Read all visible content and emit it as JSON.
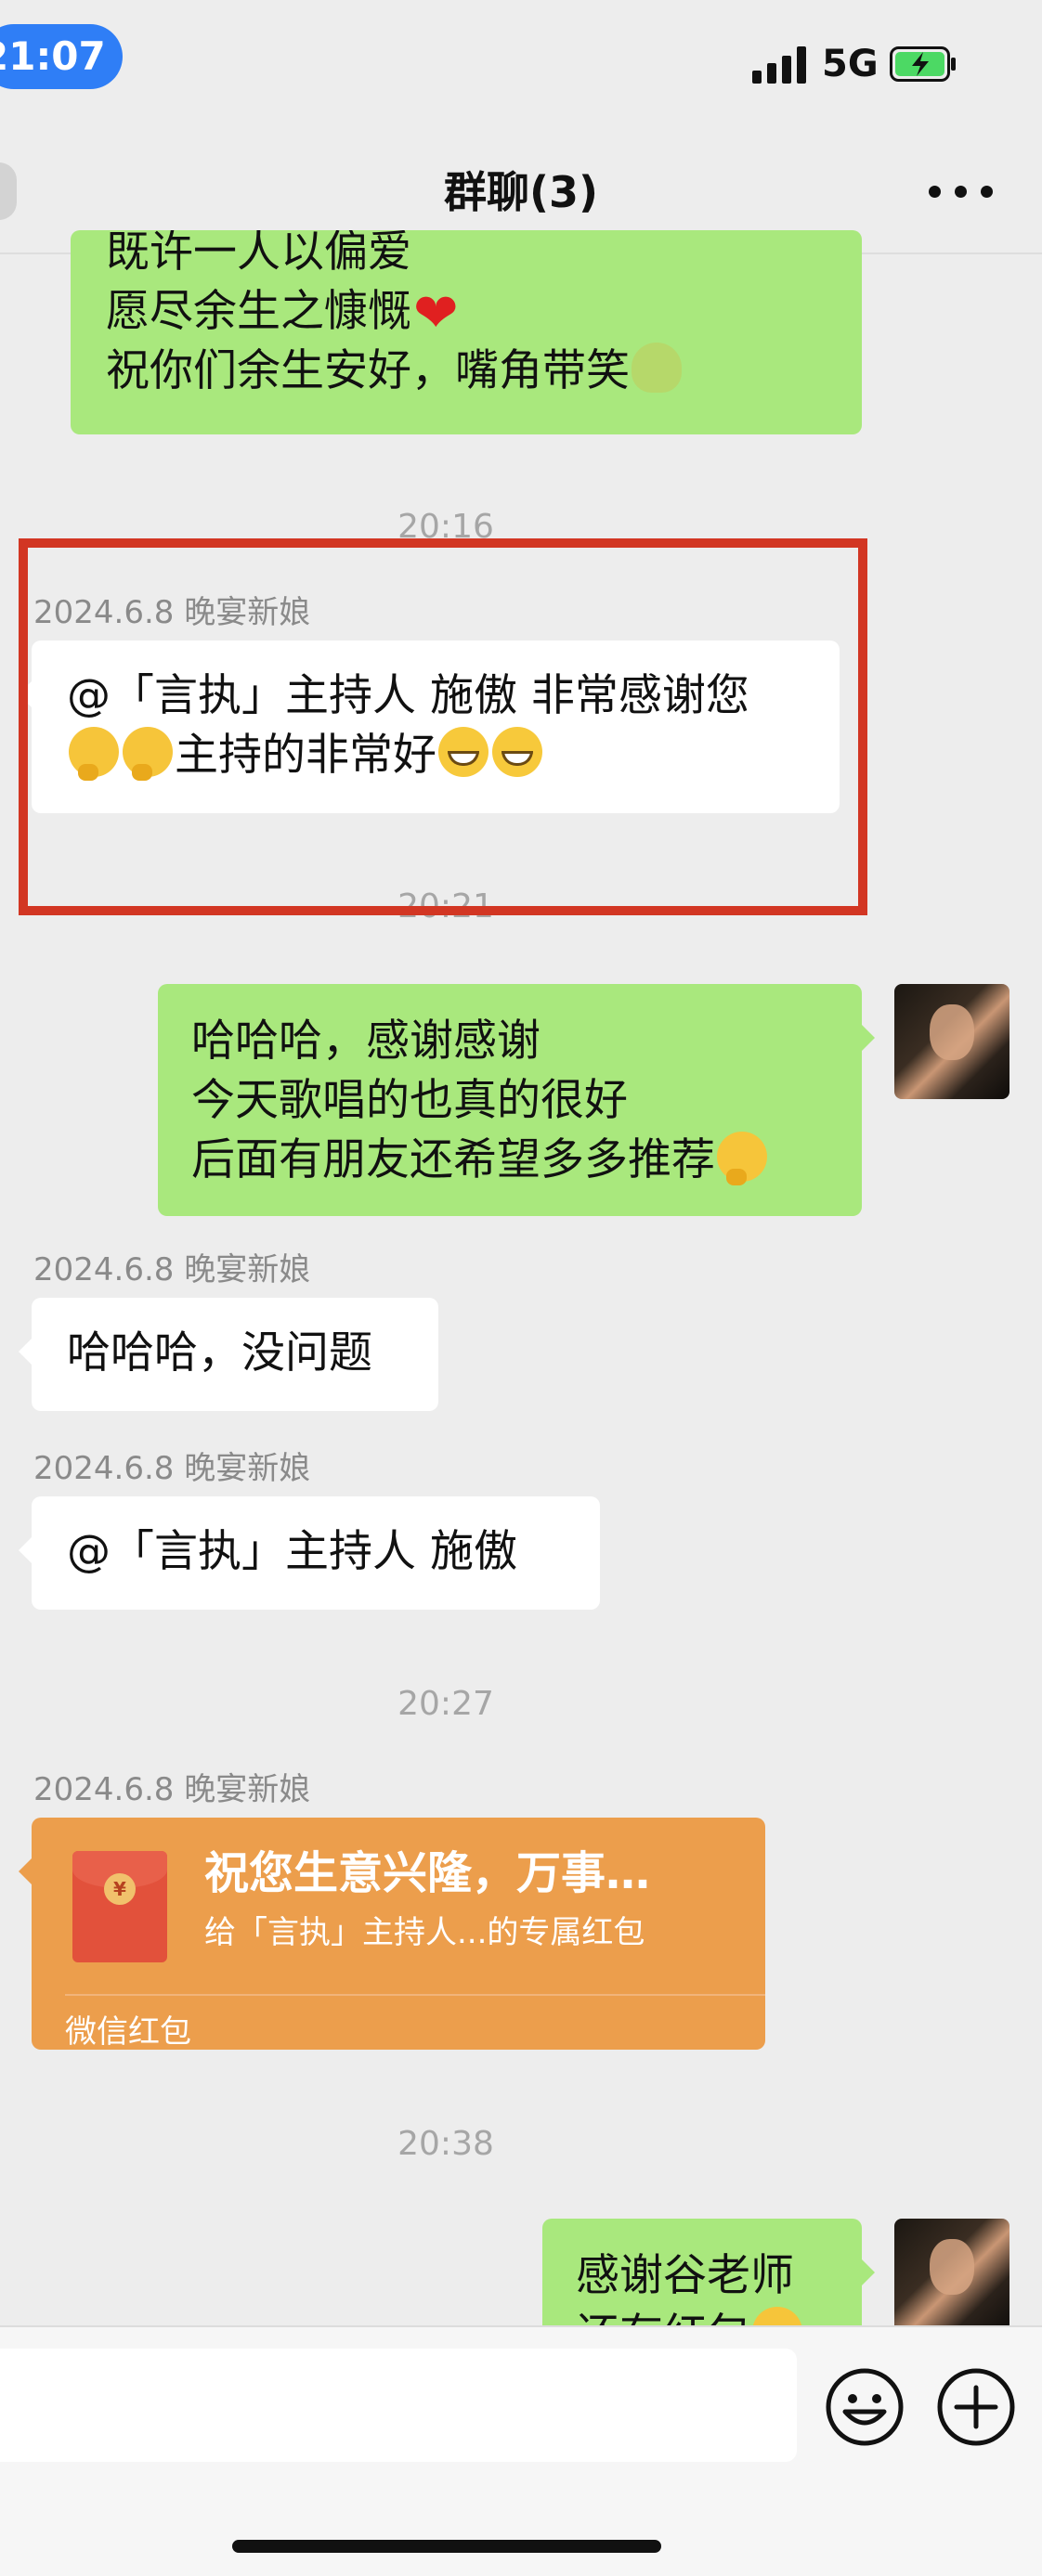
{
  "status_bar": {
    "time": "21:07",
    "network": "5G"
  },
  "nav": {
    "title": "群聊(3)"
  },
  "messages": {
    "m1": {
      "lines": [
        "既许一人以偏爱",
        "愿尽余生之慷慨",
        "祝你们余生安好，嘴角带笑"
      ]
    },
    "ts1": "20:16",
    "m2": {
      "sender": "2024.6.8 晚宴新娘",
      "line1": "@「言执」主持人 施傲 非常感谢您",
      "line2": "主持的非常好"
    },
    "ts2": "20:21",
    "m3": {
      "lines": [
        "哈哈哈，感谢感谢",
        "今天歌唱的也真的很好",
        "后面有朋友还希望多多推荐"
      ]
    },
    "m4": {
      "sender": "2024.6.8 晚宴新娘",
      "text": "哈哈哈，没问题"
    },
    "m5": {
      "sender": "2024.6.8 晚宴新娘",
      "text": "@「言执」主持人 施傲"
    },
    "ts3": "20:27",
    "m6": {
      "sender": "2024.6.8 晚宴新娘",
      "title": "祝您生意兴隆，万事…",
      "subtitle": "给「言执」主持人...的专属红包",
      "footer": "微信红包",
      "coin": "¥"
    },
    "ts4": "20:38",
    "m7": {
      "lines": [
        "感谢谷老师",
        "还有红包"
      ]
    }
  },
  "input": {
    "value": ""
  },
  "icons": [
    "signal-icon",
    "battery-icon",
    "back-icon",
    "more-icon",
    "emoji-button-icon",
    "plus-icon"
  ]
}
